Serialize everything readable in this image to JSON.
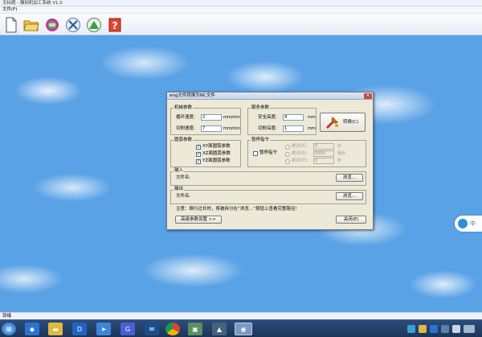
{
  "window": {
    "title": "无标题 - 雕刻机加工系统 V1.0"
  },
  "menu": {
    "file": "文件(F)"
  },
  "toolbar": {
    "icons": [
      "new-file-icon",
      "open-folder-icon",
      "engrave-icon",
      "convert-icon",
      "mill-icon",
      "help-icon"
    ]
  },
  "dialog": {
    "title": "eng文件转换为NC文件",
    "machine_group": {
      "label": "机械参数",
      "feed_speed_label": "循环速度:",
      "feed_speed_value": "2",
      "feed_speed_unit": "mm/min",
      "cut_speed_label": "切削速度:",
      "cut_speed_value": "7",
      "cut_speed_unit": "mm/min"
    },
    "service_group": {
      "label": "服务参数",
      "safe_height_label": "安全高度:",
      "safe_height_value": "4",
      "safe_height_unit": "mm",
      "cut_depth_label": "切削深度:",
      "cut_depth_value": "1",
      "cut_depth_unit": "mm"
    },
    "convert_button": "转换(C)",
    "circle_group": {
      "label": "圆弧参数",
      "opt1": "XY面圆弧参数",
      "opt2": "XZ面圆弧参数",
      "opt3": "YZ面圆弧参数"
    },
    "pause_group": {
      "label": "暂停指令",
      "pause_cmd": "暂停指令",
      "r1_label": "绝对/行:",
      "r1_value": "0",
      "r1_unit": "秒",
      "r2_label": "绝对/行:",
      "r2_value": "5000",
      "r2_unit": "毫秒",
      "r3_label": "绝对/行:",
      "r3_value": "0",
      "r3_unit": "秒"
    },
    "input_group": {
      "label": "输入",
      "file_label": "文件名:",
      "browse": "浏览..."
    },
    "output_group": {
      "label": "输出",
      "file_label": "文件名:",
      "browse": "浏览..."
    },
    "note": "注意：换行过长时，将被拆分在“浏览...”按钮上查看完整路径!",
    "advanced_button": "高级参数设置 >>",
    "close_button": "关闭(E)"
  },
  "status": {
    "text": "就绪"
  },
  "side_widget": {
    "label": "中"
  },
  "taskbar": {
    "items": [
      "start-orb",
      "app-blue",
      "folder",
      "app-d",
      "app-arrow",
      "app-g",
      "app-mail",
      "chrome",
      "app-green",
      "app-tool",
      "app-image"
    ]
  }
}
